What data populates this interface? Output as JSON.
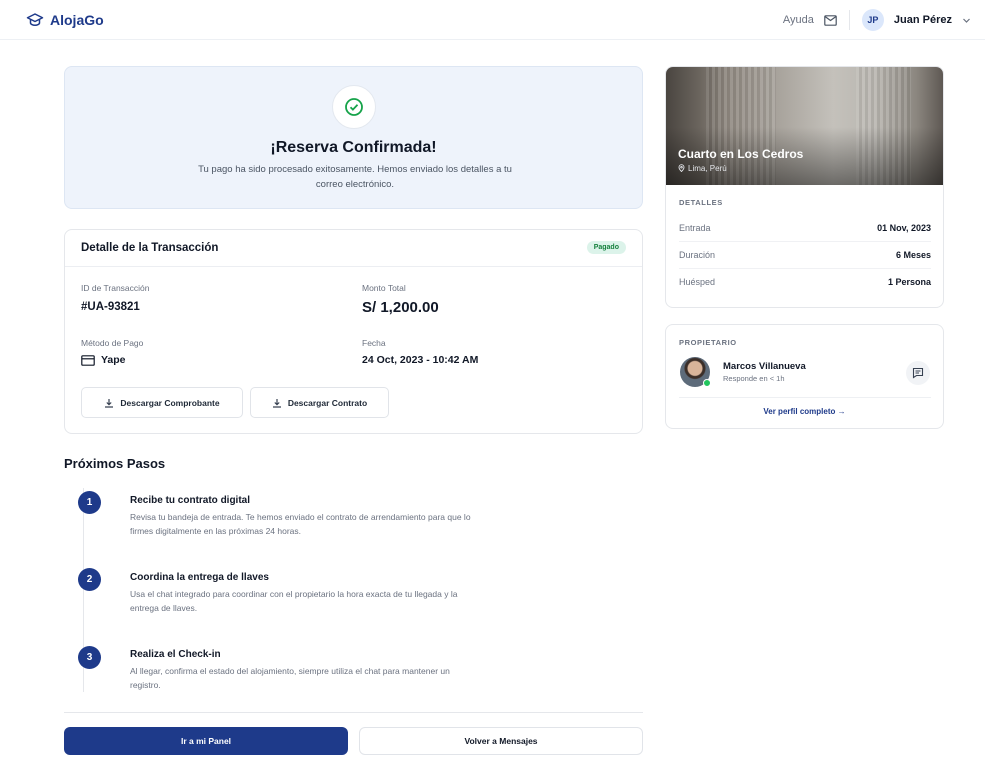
{
  "brand": {
    "name": "AlojaGo",
    "accent": "#1e3a8a"
  },
  "topbar": {
    "help": "Ayuda",
    "user_initials": "JP",
    "user_name": "Juan Pérez",
    "icons": [
      "mail-icon",
      "chevron-down-icon"
    ]
  },
  "confirmation": {
    "title": "¡Reserva Confirmada!",
    "message": "Tu pago ha sido procesado exitosamente. Hemos enviado los detalles a tu correo electrónico."
  },
  "transaction": {
    "title": "Detalle de la Transacción",
    "status": "Pagado",
    "id_label": "ID de Transacción",
    "id_value": "#UA-93821",
    "total_label": "Monto Total",
    "total_value": "S/ 1,200.00",
    "method_label": "Método de Pago",
    "method_value": "Yape",
    "date_label": "Fecha",
    "date_value": "24 Oct, 2023 - 10:42 AM",
    "download_receipt": "Descargar Comprobante",
    "download_contract": "Descargar Contrato"
  },
  "next_steps": {
    "title": "Próximos Pasos",
    "steps": [
      {
        "num": "1",
        "title": "Recibe tu contrato digital",
        "desc": "Revisa tu bandeja de entrada. Te hemos enviado el contrato de arrendamiento para que lo firmes digitalmente en las próximas 24 horas."
      },
      {
        "num": "2",
        "title": "Coordina la entrega de llaves",
        "desc": "Usa el chat integrado para coordinar con el propietario la hora exacta de tu llegada y la entrega de llaves."
      },
      {
        "num": "3",
        "title": "Realiza el Check-in",
        "desc": "Al llegar, confirma el estado del alojamiento, siempre utiliza el chat para mantener un registro."
      }
    ]
  },
  "actions": {
    "primary": "Ir a mi Panel",
    "secondary": "Volver a Mensajes"
  },
  "property": {
    "name": "Cuarto en Los Cedros",
    "location": "Lima, Perú",
    "details_label": "DETALLES",
    "details": [
      {
        "key": "Entrada",
        "value": "01 Nov, 2023"
      },
      {
        "key": "Duración",
        "value": "6 Meses"
      },
      {
        "key": "Huésped",
        "value": "1 Persona"
      }
    ]
  },
  "owner": {
    "label": "PROPIETARIO",
    "name": "Marcos Villanueva",
    "response": "Responde en < 1h",
    "profile_link": "Ver perfil completo →"
  }
}
